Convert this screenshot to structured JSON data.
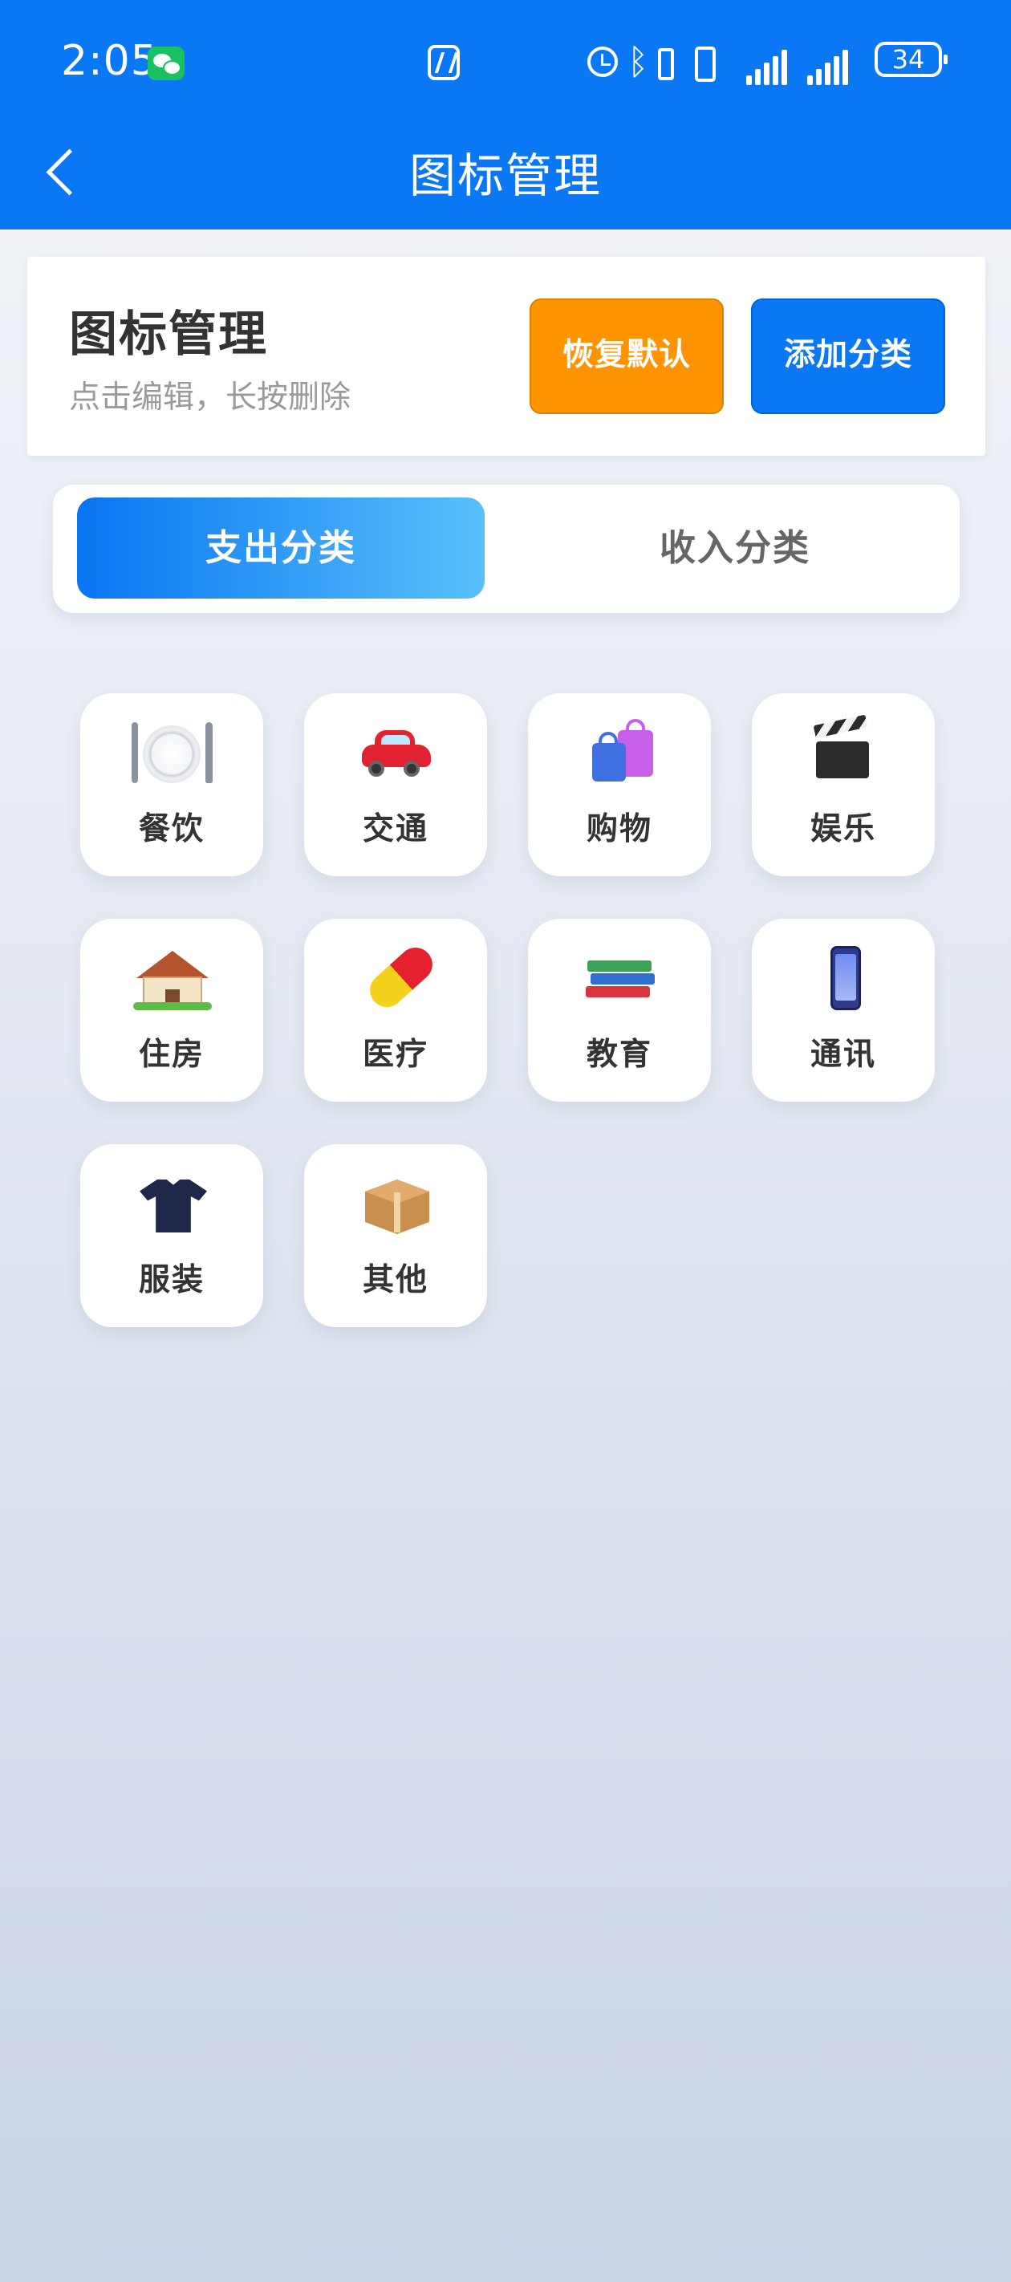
{
  "status_bar": {
    "time": "2:05",
    "battery": "34",
    "icons": [
      "wechat-icon",
      "nfc-icon",
      "alarm-icon",
      "bluetooth-icon",
      "vibrate-icon",
      "signal-icon",
      "signal-icon",
      "battery-icon"
    ]
  },
  "nav": {
    "title": "图标管理",
    "back_icon": "chevron-left-icon"
  },
  "header": {
    "title": "图标管理",
    "subtitle": "点击编辑，长按删除",
    "restore_label": "恢复默认",
    "add_label": "添加分类",
    "colors": {
      "restore": "#ff9400",
      "add": "#0a78f5"
    }
  },
  "tabs": [
    {
      "label": "支出分类",
      "active": true
    },
    {
      "label": "收入分类",
      "active": false
    }
  ],
  "categories": [
    {
      "label": "餐饮",
      "icon": "dining-icon"
    },
    {
      "label": "交通",
      "icon": "car-icon"
    },
    {
      "label": "购物",
      "icon": "shopping-bags-icon"
    },
    {
      "label": "娱乐",
      "icon": "clapper-board-icon"
    },
    {
      "label": "住房",
      "icon": "house-icon"
    },
    {
      "label": "医疗",
      "icon": "pill-icon"
    },
    {
      "label": "教育",
      "icon": "books-icon"
    },
    {
      "label": "通讯",
      "icon": "phone-icon"
    },
    {
      "label": "服装",
      "icon": "shirt-icon"
    },
    {
      "label": "其他",
      "icon": "package-icon"
    }
  ]
}
